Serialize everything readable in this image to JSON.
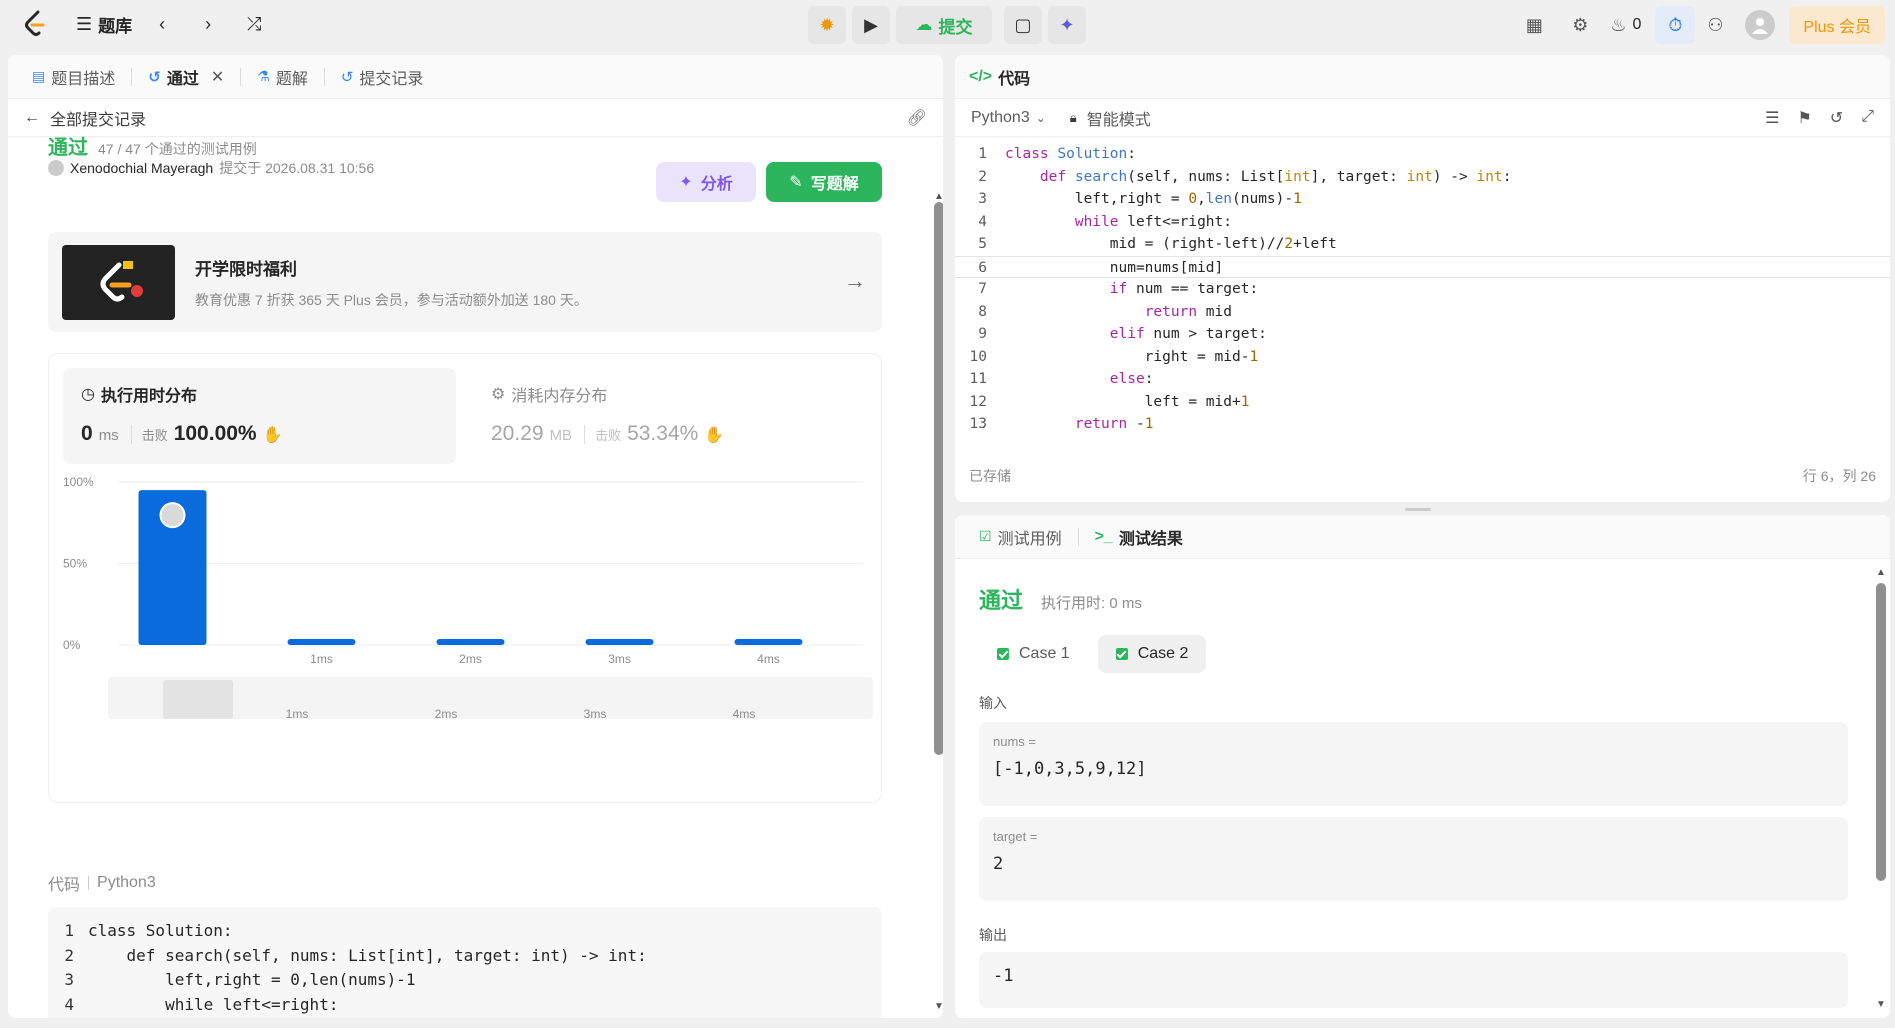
{
  "topbar": {
    "problem_list_label": "题库",
    "submit_label": "提交",
    "streak_count": "0",
    "plus_label": "Plus 会员"
  },
  "left": {
    "tabs": [
      {
        "label": "题目描述",
        "icon": "document-icon"
      },
      {
        "label": "通过",
        "icon": "history-icon"
      },
      {
        "label": "题解",
        "icon": "flask-icon"
      },
      {
        "label": "提交记录",
        "icon": "history-icon"
      }
    ],
    "back_label": "全部提交记录",
    "status": "通过",
    "testcases": "47 / 47 个通过的测试用例",
    "user": "Xenodochial Mayeragh",
    "submitted_at": "提交于 2026.08.31 10:56",
    "analyze_label": "分析",
    "write_solution_label": "写题解",
    "promo": {
      "title": "开学限时福利",
      "subtitle": "教育优惠 7 折获 365 天 Plus 会员，参与活动额外加送 180 天。"
    },
    "runtime": {
      "title": "执行用时分布",
      "value": "0",
      "unit": "ms",
      "beats_label": "击败",
      "beats": "100.00%"
    },
    "memory": {
      "title": "消耗内存分布",
      "value": "20.29",
      "unit": "MB",
      "beats_label": "击败",
      "beats": "53.34%"
    },
    "code_label": "代码",
    "code_lang": "Python3",
    "code_lines": [
      "class Solution:",
      "    def search(self, nums: List[int], target: int) -> int:",
      "        left,right = 0,len(nums)-1",
      "        while left<=right:",
      "            mid = (right-left)//2+left",
      "            num=nums[mid]"
    ]
  },
  "chart_data": {
    "type": "bar",
    "categories": [
      "0ms",
      "1ms",
      "2ms",
      "3ms",
      "4ms"
    ],
    "tick_labels": [
      "",
      "1ms",
      "2ms",
      "3ms",
      "4ms"
    ],
    "values": [
      95,
      1,
      1,
      1,
      1
    ],
    "y_ticks": [
      "100%",
      "50%",
      "0%"
    ],
    "ylim": [
      0,
      100
    ],
    "highlight_index": 0,
    "bar_color": "#0a6bdc",
    "grid": true
  },
  "code_panel": {
    "title": "代码",
    "language": "Python3",
    "mode": "智能模式",
    "saved": "已存储",
    "cursor": "行 6，列 26"
  },
  "result_panel": {
    "tab_testcase": "测试用例",
    "tab_result": "测试结果",
    "status": "通过",
    "runtime": "执行用时: 0 ms",
    "cases": [
      "Case 1",
      "Case 2"
    ],
    "input_label": "输入",
    "output_label": "输出",
    "inputs": [
      {
        "name": "nums =",
        "value": "[-1,0,3,5,9,12]"
      },
      {
        "name": "target =",
        "value": "2"
      }
    ],
    "output": "-1"
  }
}
